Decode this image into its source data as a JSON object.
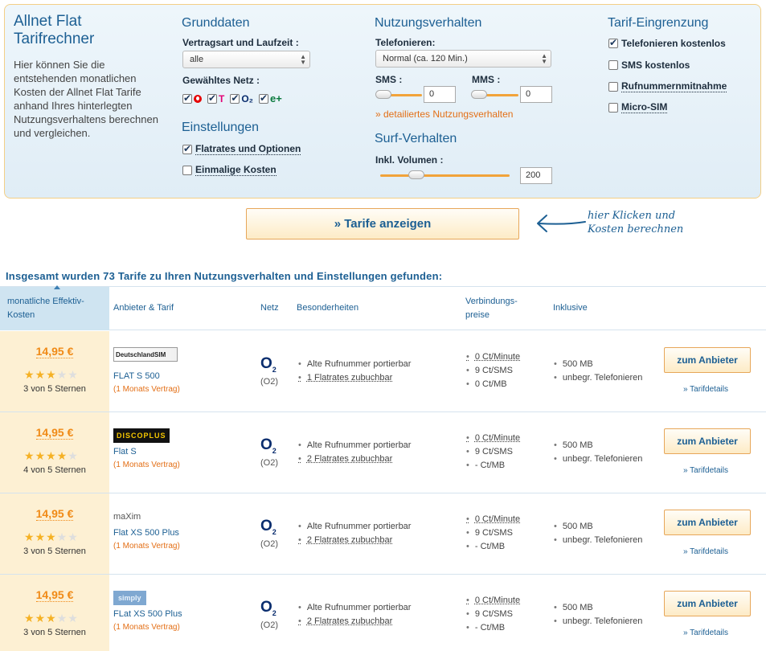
{
  "calculator": {
    "title": "Allnet Flat Tarifrechner",
    "intro": "Hier können Sie die entstehenden monatlichen Kosten der Allnet Flat Tarife anhand Ihres hinterlegten Nutzungsverhaltens berechnen und vergleichen.",
    "grunddaten": {
      "heading": "Grunddaten",
      "vertragsart_label": "Vertragsart und Laufzeit :",
      "vertragsart_value": "alle",
      "netz_label": "Gewähltes Netz :",
      "networks": [
        {
          "icon": "vodafone-icon",
          "checked": true
        },
        {
          "icon": "telekom-icon",
          "label": "T",
          "checked": true
        },
        {
          "icon": "o2-icon",
          "label": "O₂",
          "checked": true
        },
        {
          "icon": "eplus-icon",
          "label": "e+",
          "checked": true
        }
      ]
    },
    "einstellungen": {
      "heading": "Einstellungen",
      "flatrates_label": "Flatrates und Optionen",
      "flatrates_checked": true,
      "einmalige_label": "Einmalige Kosten",
      "einmalige_checked": false
    },
    "nutzung": {
      "heading": "Nutzungsverhalten",
      "telefonieren_label": "Telefonieren:",
      "telefonieren_value": "Normal (ca. 120 Min.)",
      "sms_label": "SMS :",
      "sms_value": "0",
      "mms_label": "MMS :",
      "mms_value": "0",
      "detail_link": "» detailiertes Nutzungsverhalten"
    },
    "surf": {
      "heading": "Surf-Verhalten",
      "volumen_label": "Inkl. Volumen :",
      "volumen_value": "200",
      "volumen_level": 0.28
    },
    "eingrenzung": {
      "heading": "Tarif-Eingrenzung",
      "options": [
        {
          "label": "Telefonieren kostenlos",
          "checked": true
        },
        {
          "label": "SMS kostenlos",
          "checked": false
        },
        {
          "label": "Rufnummernmitnahme",
          "checked": false
        },
        {
          "label": "Micro-SIM",
          "checked": false
        }
      ]
    },
    "submit_label": "» Tarife anzeigen",
    "hint": "hier Klicken und Kosten berechnen"
  },
  "results": {
    "title": "Insgesamt wurden 73 Tarife zu Ihren Nutzungsverhalten und Einstellungen gefunden:",
    "columns": {
      "cost": "monatliche Effektiv-Kosten",
      "provider": "Anbieter & Tarif",
      "netz": "Netz",
      "besonderheiten": "Besonderheiten",
      "preise": "Verbindungs-preise",
      "inklusive": "Inklusive"
    },
    "rows": [
      {
        "price": "14,95 €",
        "stars": 3,
        "rating": "3 von 5 Sternen",
        "provider_logo": "DeutschlandSIM",
        "tarif": "FLAT S 500",
        "vertrag": "(1 Monats Vertrag)",
        "netz": "(O2)",
        "besonderheiten": [
          "Alte Rufnummer portierbar",
          "1 Flatrates zubuchbar"
        ],
        "preise": [
          "0 Ct/Minute",
          "9 Ct/SMS",
          "0 Ct/MB"
        ],
        "inklusive": [
          "500 MB",
          "unbegr. Telefonieren"
        ],
        "button": "zum Anbieter",
        "details": "» Tarifdetails"
      },
      {
        "price": "14,95 €",
        "stars": 4,
        "rating": "4 von 5 Sternen",
        "provider_logo": "DISCOPLUS",
        "tarif": "Flat S",
        "vertrag": "(1 Monats Vertrag)",
        "netz": "(O2)",
        "besonderheiten": [
          "Alte Rufnummer portierbar",
          "2 Flatrates zubuchbar"
        ],
        "preise": [
          "0 Ct/Minute",
          "9 Ct/SMS",
          "- Ct/MB"
        ],
        "inklusive": [
          "500 MB",
          "unbegr. Telefonieren"
        ],
        "button": "zum Anbieter",
        "details": "» Tarifdetails"
      },
      {
        "price": "14,95 €",
        "stars": 3,
        "rating": "3 von 5 Sternen",
        "provider_logo": "maXim",
        "tarif": "Flat XS 500 Plus",
        "vertrag": "(1 Monats Vertrag)",
        "netz": "(O2)",
        "besonderheiten": [
          "Alte Rufnummer portierbar",
          "2 Flatrates zubuchbar"
        ],
        "preise": [
          "0 Ct/Minute",
          "9 Ct/SMS",
          "- Ct/MB"
        ],
        "inklusive": [
          "500 MB",
          "unbegr. Telefonieren"
        ],
        "button": "zum Anbieter",
        "details": "» Tarifdetails"
      },
      {
        "price": "14,95 €",
        "stars": 3,
        "rating": "3 von 5 Sternen",
        "provider_logo": "simply",
        "tarif": "FLat XS 500 Plus",
        "vertrag": "(1 Monats Vertrag)",
        "netz": "(O2)",
        "besonderheiten": [
          "Alte Rufnummer portierbar",
          "2 Flatrates zubuchbar"
        ],
        "preise": [
          "0 Ct/Minute",
          "9 Ct/SMS",
          "- Ct/MB"
        ],
        "inklusive": [
          "500 MB",
          "unbegr. Telefonieren"
        ],
        "button": "zum Anbieter",
        "details": "» Tarifdetails"
      }
    ]
  },
  "colors": {
    "accent": "#1c5f93",
    "orange": "#f08a16",
    "panel_border": "#f3cf86"
  }
}
